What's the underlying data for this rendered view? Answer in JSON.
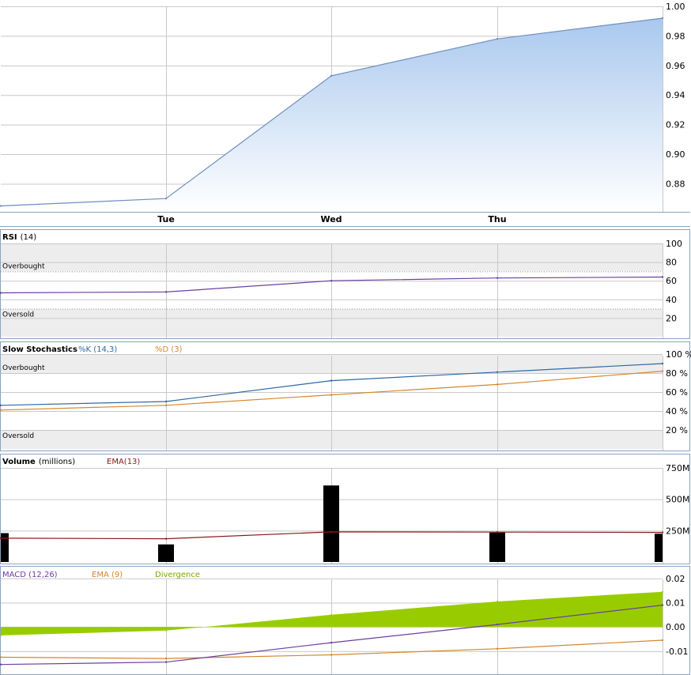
{
  "colors": {
    "price_line": "#6f8fbe",
    "price_fill_top": "#a9c8ee",
    "price_fill_bottom": "#ffffff",
    "panel_border": "#8aa3c0",
    "grid": "#c8c8c8",
    "zone": "#ededed",
    "rsi": "#6b3fa0",
    "stoch_k": "#2f6aa3",
    "stoch_d": "#d4862d",
    "volume_bar": "#000000",
    "volume_ema": "#8b1a1a",
    "macd": "#6b3fa0",
    "macd_ema": "#d4862d",
    "divergence": "#99cc00"
  },
  "chart_data": [
    {
      "type": "area",
      "name": "price",
      "categories": [
        "Tue",
        "Wed",
        "Thu"
      ],
      "x": [
        0,
        1,
        2,
        3,
        4
      ],
      "values": [
        0.865,
        0.87,
        0.953,
        0.978,
        0.992
      ],
      "ylim": [
        0.861,
        1.0
      ],
      "yticks": [
        "1.00",
        "0.98",
        "0.96",
        "0.94",
        "0.92",
        "0.90",
        "0.88"
      ],
      "ytick_values": [
        1.0,
        0.98,
        0.96,
        0.94,
        0.92,
        0.9,
        0.88
      ]
    },
    {
      "type": "line",
      "name": "rsi",
      "title": "RSI",
      "param": "(14)",
      "x": [
        0,
        1,
        2,
        3,
        4
      ],
      "values": [
        47,
        48,
        60,
        63,
        64
      ],
      "ylim": [
        0,
        100
      ],
      "yticks": [
        "100",
        "80",
        "60",
        "40",
        "20"
      ],
      "ytick_values": [
        100,
        80,
        60,
        40,
        20
      ],
      "overbought_label": "Overbought",
      "oversold_label": "Oversold",
      "overbought_level": 70,
      "oversold_level": 30
    },
    {
      "type": "line",
      "name": "stochastics",
      "title": "Slow Stochastics",
      "legend": [
        "%K (14,3)",
        "%D (3)"
      ],
      "x": [
        0,
        1,
        2,
        3,
        4
      ],
      "series": [
        {
          "values": [
            46,
            50,
            72,
            81,
            90
          ]
        },
        {
          "values": [
            41,
            46,
            57,
            68,
            82
          ]
        }
      ],
      "ylim": [
        0,
        100
      ],
      "yticks": [
        "100 %",
        "80 %",
        "60 %",
        "40 %",
        "20 %"
      ],
      "ytick_values": [
        100,
        80,
        60,
        40,
        20
      ],
      "overbought_label": "Overbought",
      "oversold_label": "Oversold",
      "overbought_level": 80,
      "oversold_level": 20
    },
    {
      "type": "bar",
      "name": "volume",
      "title": "Volume",
      "param": "(millions)",
      "legend": [
        "EMA(13)"
      ],
      "x": [
        0,
        1,
        2,
        3,
        4
      ],
      "values": [
        230,
        140,
        610,
        235,
        225
      ],
      "ema": [
        190,
        185,
        240,
        238,
        236
      ],
      "ylim": [
        0,
        750
      ],
      "yticks": [
        "750M",
        "500M",
        "250M"
      ],
      "ytick_values": [
        750,
        500,
        250
      ]
    },
    {
      "type": "line",
      "name": "macd",
      "legend": [
        "MACD (12,26)",
        "EMA (9)",
        "Divergence"
      ],
      "x": [
        0,
        1,
        2,
        3,
        4
      ],
      "macd": [
        -0.0155,
        -0.0145,
        -0.0065,
        0.001,
        0.009
      ],
      "ema": [
        -0.0125,
        -0.013,
        -0.0115,
        -0.009,
        -0.0055
      ],
      "divergence": [
        -0.0035,
        -0.0015,
        0.005,
        0.0105,
        0.0145
      ],
      "ylim": [
        -0.0195,
        0.0245
      ],
      "yticks": [
        "0.02",
        "0.01",
        "0.00",
        "-0.01"
      ],
      "ytick_values": [
        0.02,
        0.01,
        0.0,
        -0.01
      ]
    }
  ]
}
